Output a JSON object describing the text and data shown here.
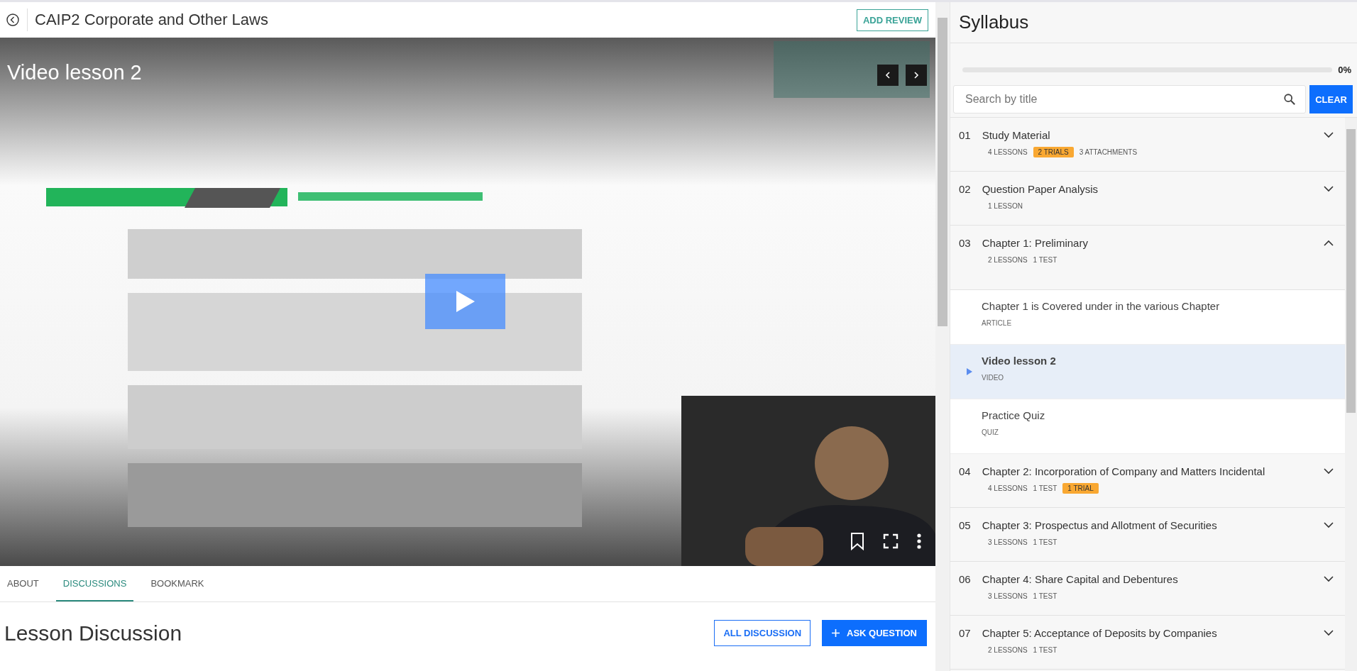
{
  "header": {
    "title": "CAIP2 Corporate and Other Laws",
    "action": "ADD REVIEW"
  },
  "video": {
    "title": "Video lesson 2",
    "kind": "picture"
  },
  "tabs": [
    {
      "label": "ABOUT",
      "selected": false
    },
    {
      "label": "DISCUSSIONS",
      "selected": true
    },
    {
      "label": "BOOKMARK",
      "selected": false
    }
  ],
  "discussion": {
    "heading": "Lesson Discussion",
    "buttons": [
      {
        "label": "ALL DISCUSSION",
        "kind": "outline"
      },
      {
        "label": "ASK QUESTION",
        "kind": "primary"
      }
    ]
  },
  "syllabus": {
    "title": "Syllabus",
    "progress": {
      "level": 0,
      "reading": "0%"
    },
    "search": {
      "placeholder": "Search by title"
    },
    "clear": "CLEAR",
    "sections": [
      {
        "number": "01",
        "title": "Study Material",
        "expanded": false,
        "meta": [
          {
            "text": "4 LESSONS",
            "highlighted": false
          },
          {
            "text": "2 TRIALS",
            "highlighted": true
          },
          {
            "text": "3 ATTACHMENTS",
            "highlighted": false
          }
        ]
      },
      {
        "number": "02",
        "title": "Question Paper Analysis",
        "expanded": false,
        "meta": [
          {
            "text": "1 LESSON",
            "highlighted": false
          }
        ]
      },
      {
        "number": "03",
        "title": "Chapter 1: Preliminary",
        "expanded": true,
        "meta": [
          {
            "text": "2 LESSONS",
            "highlighted": false
          },
          {
            "text": "1 TEST",
            "highlighted": false
          }
        ],
        "children": [
          {
            "title": "Chapter 1 is Covered under in the various Chapter",
            "type": "ARTICLE",
            "selected": false
          },
          {
            "title": "Video lesson 2",
            "type": "VIDEO",
            "selected": true
          },
          {
            "title": "Practice Quiz",
            "type": "QUIZ",
            "selected": false
          }
        ]
      },
      {
        "number": "04",
        "title": "Chapter 2: Incorporation of Company and Matters Incidental",
        "expanded": false,
        "meta": [
          {
            "text": "4 LESSONS",
            "highlighted": false
          },
          {
            "text": "1 TEST",
            "highlighted": false
          },
          {
            "text": "1 TRIAL",
            "highlighted": true
          }
        ]
      },
      {
        "number": "05",
        "title": "Chapter 3: Prospectus and Allotment of Securities",
        "expanded": false,
        "meta": [
          {
            "text": "3 LESSONS",
            "highlighted": false
          },
          {
            "text": "1 TEST",
            "highlighted": false
          }
        ]
      },
      {
        "number": "06",
        "title": "Chapter 4: Share Capital and Debentures",
        "expanded": false,
        "meta": [
          {
            "text": "3 LESSONS",
            "highlighted": false
          },
          {
            "text": "1 TEST",
            "highlighted": false
          }
        ]
      },
      {
        "number": "07",
        "title": "Chapter 5: Acceptance of Deposits by Companies",
        "expanded": false,
        "meta": [
          {
            "text": "2 LESSONS",
            "highlighted": false
          },
          {
            "text": "1 TEST",
            "highlighted": false
          }
        ]
      }
    ]
  }
}
